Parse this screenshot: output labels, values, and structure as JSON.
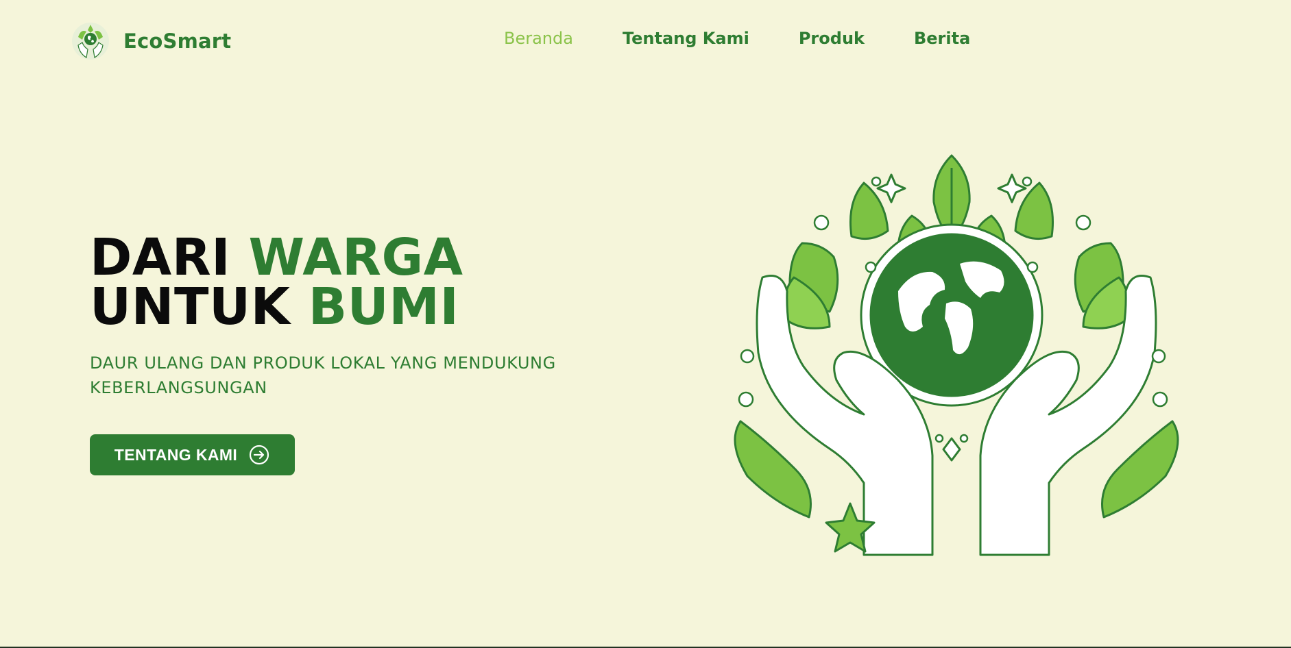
{
  "brand": {
    "name": "EcoSmart",
    "logo_icon": "earth-hands-logo-icon"
  },
  "nav": {
    "items": [
      {
        "label": "Beranda",
        "active": true
      },
      {
        "label": "Tentang Kami",
        "active": false
      },
      {
        "label": "Produk",
        "active": false
      },
      {
        "label": "Berita",
        "active": false
      }
    ]
  },
  "hero": {
    "title_line1_black": "DARI ",
    "title_line1_green": "WARGA",
    "title_line2_black": "UNTUK ",
    "title_line2_green": "BUMI",
    "subtitle": "DAUR ULANG DAN PRODUK LOKAL YANG MENDUKUNG KEBERLANGSUNGAN",
    "cta_label": "TENTANG KAMI",
    "cta_icon": "arrow-circle-right-icon",
    "illustration": "hands-holding-earth-illustration"
  },
  "colors": {
    "background": "#f5f5da",
    "primary": "#2e7d32",
    "active_nav": "#8bc34a",
    "leaf_light": "#7cc243",
    "title_dark": "#0b0b0b"
  }
}
